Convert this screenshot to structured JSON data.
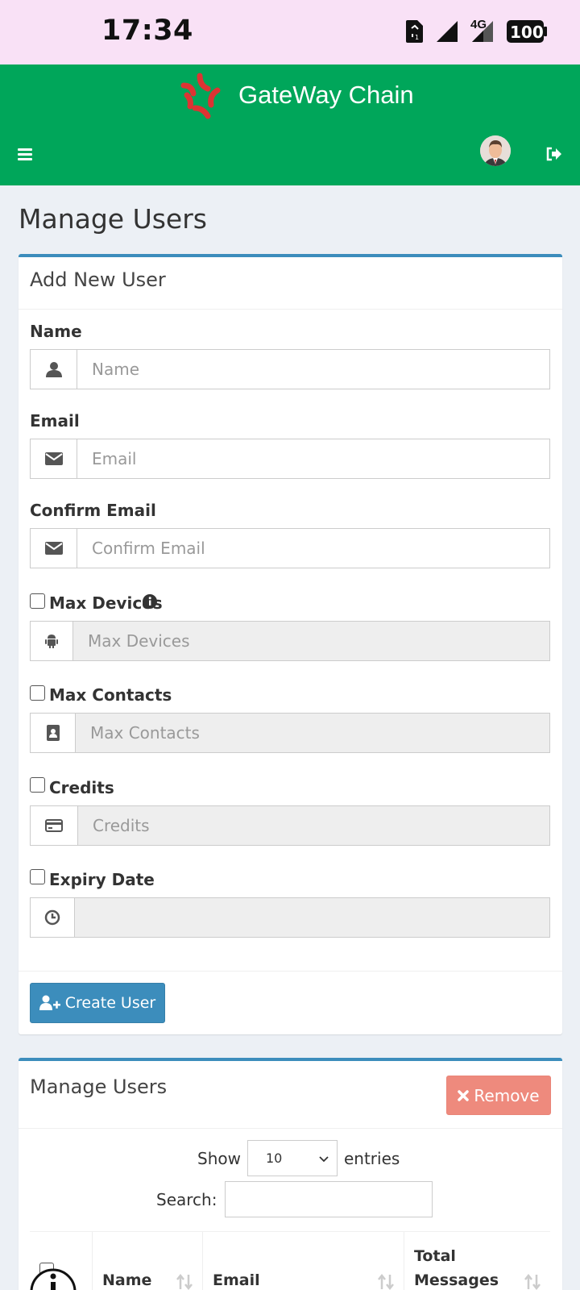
{
  "status_bar": {
    "time": "17:34",
    "network": "4G",
    "battery": "100"
  },
  "header": {
    "brand": "GateWay Chain",
    "color": "#00a65a"
  },
  "page_title": "Manage Users",
  "add_user": {
    "title": "Add New User",
    "name": {
      "label": "Name",
      "placeholder": "Name"
    },
    "email": {
      "label": "Email",
      "placeholder": "Email"
    },
    "confirm_email": {
      "label": "Confirm Email",
      "placeholder": "Confirm Email"
    },
    "max_devices": {
      "label": "Max Devices",
      "placeholder": "Max Devices",
      "checked": false
    },
    "max_contacts": {
      "label": "Max Contacts",
      "placeholder": "Max Contacts",
      "checked": false
    },
    "credits": {
      "label": "Credits",
      "placeholder": "Credits",
      "checked": false
    },
    "expiry_date": {
      "label": "Expiry Date",
      "value": "",
      "checked": false
    },
    "create_button": "Create User"
  },
  "manage_users": {
    "title": "Manage Users",
    "remove_button": "Remove",
    "show_label": "Show",
    "entries_value": "10",
    "entries_label": "entries",
    "search_label": "Search:",
    "columns": [
      "Name",
      "Email",
      "Total Messages"
    ]
  },
  "colors": {
    "primary": "#3c8dbc",
    "danger": "#ee8a7d",
    "header": "#00a65a",
    "background": "#ecf0f5"
  },
  "icons": [
    "user-icon",
    "envelope-icon",
    "android-icon",
    "address-book-icon",
    "credit-card-icon",
    "clock-icon",
    "info-icon",
    "user-plus-icon",
    "times-icon",
    "sort-icon",
    "sign-out-icon",
    "hamburger-icon"
  ]
}
